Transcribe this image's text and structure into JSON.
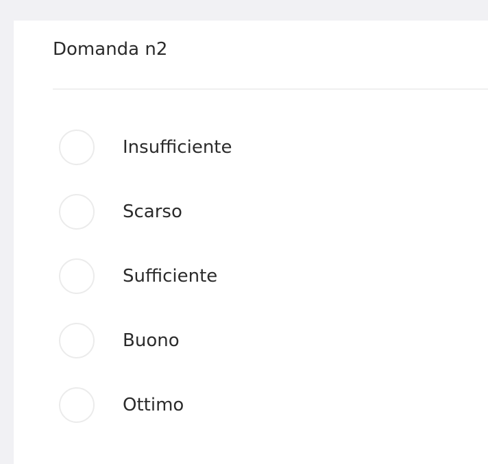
{
  "question": {
    "title": "Domanda n2"
  },
  "options": [
    {
      "label": "Insufficiente",
      "selected": false
    },
    {
      "label": "Scarso",
      "selected": false
    },
    {
      "label": "Sufficiente",
      "selected": false
    },
    {
      "label": "Buono",
      "selected": false
    },
    {
      "label": "Ottimo",
      "selected": false
    }
  ],
  "colors": {
    "page_background": "#f1f1f4",
    "card_background": "#ffffff",
    "text": "#2b2b2b",
    "radio_border": "#ebebeb",
    "divider": "#efefef"
  }
}
